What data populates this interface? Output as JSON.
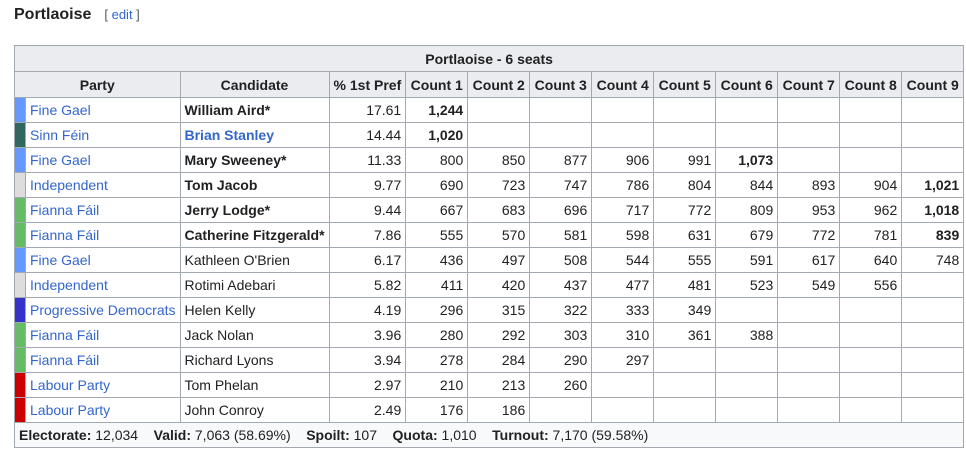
{
  "heading": {
    "title": "Portlaoise",
    "edit_open": "[ ",
    "edit_label": "edit",
    "edit_close": " ]"
  },
  "table": {
    "caption": "Portlaoise - 6 seats",
    "headers": [
      "Party",
      "Candidate",
      "% 1st Pref",
      "Count 1",
      "Count 2",
      "Count 3",
      "Count 4",
      "Count 5",
      "Count 6",
      "Count 7",
      "Count 8",
      "Count 9"
    ],
    "party_colors": {
      "Fine Gael": "#6699ff",
      "Sinn Féin": "#326760",
      "Independent": "#dddddd",
      "Fianna Fáil": "#66bb66",
      "Progressive Democrats": "#3333cc",
      "Labour Party": "#cc0000"
    },
    "rows": [
      {
        "party": "Fine Gael",
        "candidate": "William Aird*",
        "pct": "17.61",
        "counts": [
          "1,244",
          "",
          "",
          "",
          "",
          "",
          "",
          "",
          ""
        ],
        "bold_index": 0,
        "elected": true
      },
      {
        "party": "Sinn Féin",
        "candidate": "Brian Stanley",
        "pct": "14.44",
        "counts": [
          "1,020",
          "",
          "",
          "",
          "",
          "",
          "",
          "",
          ""
        ],
        "bold_index": 0,
        "elected": true
      },
      {
        "party": "Fine Gael",
        "candidate": "Mary Sweeney*",
        "pct": "11.33",
        "counts": [
          "800",
          "850",
          "877",
          "906",
          "991",
          "1,073",
          "",
          "",
          ""
        ],
        "bold_index": 5,
        "elected": true
      },
      {
        "party": "Independent",
        "candidate": "Tom Jacob",
        "pct": "9.77",
        "counts": [
          "690",
          "723",
          "747",
          "786",
          "804",
          "844",
          "893",
          "904",
          "1,021"
        ],
        "bold_index": 8,
        "elected": true
      },
      {
        "party": "Fianna Fáil",
        "candidate": "Jerry Lodge*",
        "pct": "9.44",
        "counts": [
          "667",
          "683",
          "696",
          "717",
          "772",
          "809",
          "953",
          "962",
          "1,018"
        ],
        "bold_index": 8,
        "elected": true
      },
      {
        "party": "Fianna Fáil",
        "candidate": "Catherine Fitzgerald*",
        "pct": "7.86",
        "counts": [
          "555",
          "570",
          "581",
          "598",
          "631",
          "679",
          "772",
          "781",
          "839"
        ],
        "bold_index": 8,
        "elected": true
      },
      {
        "party": "Fine Gael",
        "candidate": "Kathleen O'Brien",
        "pct": "6.17",
        "counts": [
          "436",
          "497",
          "508",
          "544",
          "555",
          "591",
          "617",
          "640",
          "748"
        ],
        "bold_index": -1,
        "elected": false
      },
      {
        "party": "Independent",
        "candidate": "Rotimi Adebari",
        "pct": "5.82",
        "counts": [
          "411",
          "420",
          "437",
          "477",
          "481",
          "523",
          "549",
          "556",
          ""
        ],
        "bold_index": -1,
        "elected": false
      },
      {
        "party": "Progressive Democrats",
        "candidate": "Helen Kelly",
        "pct": "4.19",
        "counts": [
          "296",
          "315",
          "322",
          "333",
          "349",
          "",
          "",
          "",
          ""
        ],
        "bold_index": -1,
        "elected": false
      },
      {
        "party": "Fianna Fáil",
        "candidate": "Jack Nolan",
        "pct": "3.96",
        "counts": [
          "280",
          "292",
          "303",
          "310",
          "361",
          "388",
          "",
          "",
          ""
        ],
        "bold_index": -1,
        "elected": false
      },
      {
        "party": "Fianna Fáil",
        "candidate": "Richard Lyons",
        "pct": "3.94",
        "counts": [
          "278",
          "284",
          "290",
          "297",
          "",
          "",
          "",
          "",
          ""
        ],
        "bold_index": -1,
        "elected": false
      },
      {
        "party": "Labour Party",
        "candidate": "Tom Phelan",
        "pct": "2.97",
        "counts": [
          "210",
          "213",
          "260",
          "",
          "",
          "",
          "",
          "",
          ""
        ],
        "bold_index": -1,
        "elected": false
      },
      {
        "party": "Labour Party",
        "candidate": "John Conroy",
        "pct": "2.49",
        "counts": [
          "176",
          "186",
          "",
          "",
          "",
          "",
          "",
          "",
          ""
        ],
        "bold_index": -1,
        "elected": false
      }
    ],
    "footer": [
      {
        "label": "Electorate:",
        "value": "12,034"
      },
      {
        "label": "Valid:",
        "value": "7,063 (58.69%)"
      },
      {
        "label": "Spoilt:",
        "value": "107"
      },
      {
        "label": "Quota:",
        "value": "1,010"
      },
      {
        "label": "Turnout:",
        "value": "7,170 (59.58%)"
      }
    ]
  }
}
